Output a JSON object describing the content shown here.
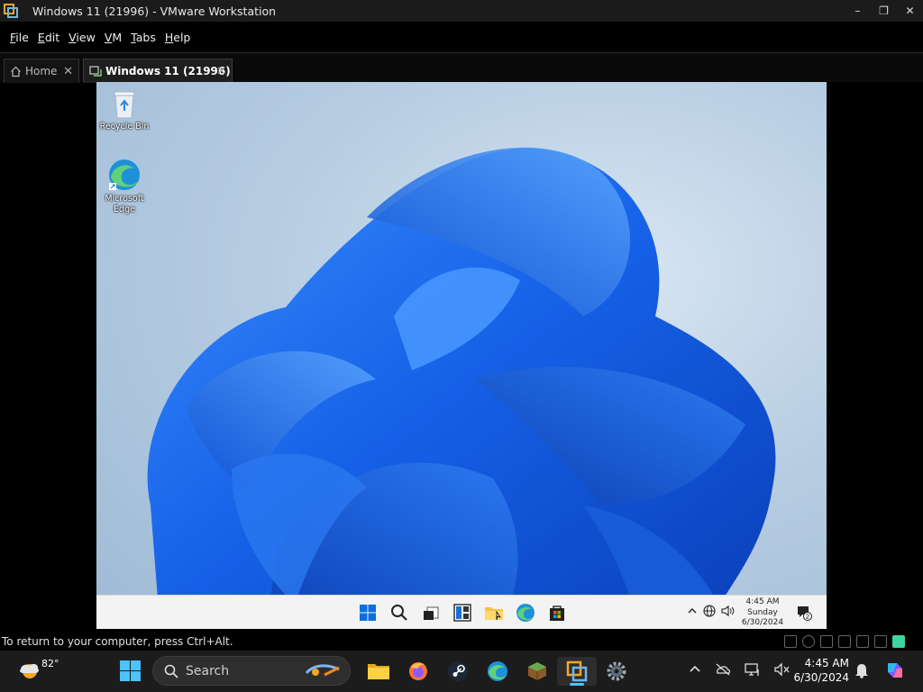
{
  "window": {
    "title": "Windows 11 (21996) - VMware Workstation",
    "controls": [
      "–",
      "❐",
      "✕"
    ]
  },
  "menu": [
    "File",
    "Edit",
    "View",
    "VM",
    "Tabs",
    "Help"
  ],
  "tabs": [
    {
      "label": "Home",
      "active": false,
      "close": "✕"
    },
    {
      "label": "Windows 11 (21996)",
      "active": true,
      "close": "✕"
    }
  ],
  "guest": {
    "desktop_icons": [
      {
        "label": "Recycle Bin",
        "icon": "recycle-bin-icon"
      },
      {
        "label": "Microsoft Edge",
        "icon": "edge-icon"
      }
    ],
    "taskbar_icons": [
      "start-icon",
      "search-icon",
      "task-view-icon",
      "widgets-icon",
      "file-explorer-icon",
      "edge-icon",
      "store-icon"
    ],
    "tray_icons": [
      "chevron-up-icon",
      "network-icon",
      "volume-icon"
    ],
    "clock": {
      "time": "4:45 AM",
      "day": "Sunday",
      "date": "6/30/2024"
    },
    "notification_count": "2",
    "wallpaper_color": "#1a6ee8"
  },
  "status": {
    "text": "To return to your computer, press Ctrl+Alt."
  },
  "host_taskbar": {
    "weather": {
      "temp": "82°"
    },
    "search_label": "Search",
    "apps": [
      {
        "name": "file-explorer-icon"
      },
      {
        "name": "firefox-icon"
      },
      {
        "name": "steam-icon"
      },
      {
        "name": "edge-icon"
      },
      {
        "name": "minecraft-icon"
      },
      {
        "name": "vmware-icon",
        "active": true
      },
      {
        "name": "settings-icon"
      }
    ],
    "clock": {
      "time": "4:45 AM",
      "date": "6/30/2024"
    },
    "accent": "#4cc2ff"
  }
}
